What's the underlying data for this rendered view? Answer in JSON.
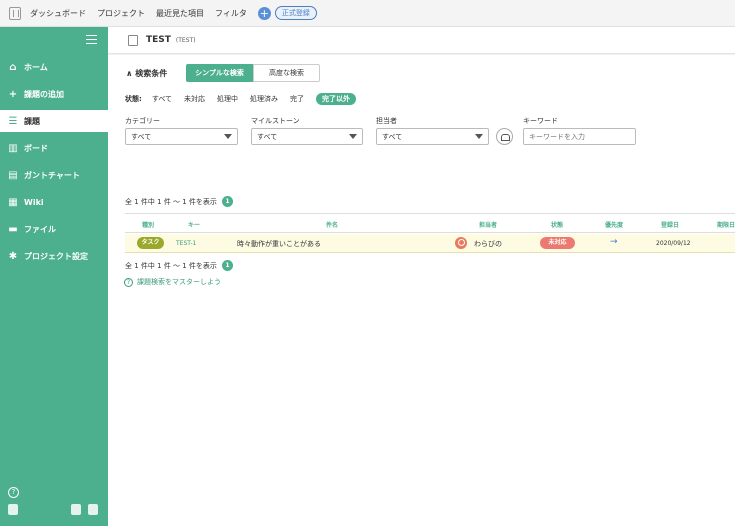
{
  "topbar": {
    "nav": [
      "ダッシュボード",
      "プロジェクト",
      "最近見た項目",
      "フィルタ"
    ],
    "register_label": "正式登録"
  },
  "sidebar": {
    "items": [
      {
        "label": "ホーム",
        "icon": "home-icon"
      },
      {
        "label": "課題の追加",
        "icon": "plus-icon"
      },
      {
        "label": "課題",
        "icon": "list-icon"
      },
      {
        "label": "ボード",
        "icon": "board-icon"
      },
      {
        "label": "ガントチャート",
        "icon": "gantt-icon"
      },
      {
        "label": "Wiki",
        "icon": "wiki-icon"
      },
      {
        "label": "ファイル",
        "icon": "folder-icon"
      },
      {
        "label": "プロジェクト設定",
        "icon": "gear-icon"
      }
    ],
    "active_index": 2
  },
  "project": {
    "name": "TEST",
    "key": "(TEST)"
  },
  "search": {
    "title": "検索条件",
    "tabs": [
      "シンプルな検索",
      "高度な検索"
    ],
    "status_label": "状態:",
    "status_options": [
      "すべて",
      "未対応",
      "処理中",
      "処理済み",
      "完了",
      "完了以外"
    ],
    "selected_status": "完了以外",
    "filters": [
      {
        "label": "カテゴリー",
        "value": "すべて"
      },
      {
        "label": "マイルストーン",
        "value": "すべて"
      },
      {
        "label": "担当者",
        "value": "すべて"
      }
    ],
    "keyword_label": "キーワード",
    "keyword_placeholder": "キーワードを入力"
  },
  "results": {
    "count_text": "全 1 件中 1 件 〜 1 件を表示",
    "count": "1",
    "columns": [
      "種別",
      "キー",
      "件名",
      "担当者",
      "状態",
      "優先度",
      "登録日",
      "期限日"
    ],
    "rows": [
      {
        "type": "タスク",
        "key": "TEST-1",
        "summary": "時々動作が重いことがある",
        "assignee": "わらびの",
        "status": "未対応",
        "priority": "→",
        "created": "2020/09/12"
      }
    ]
  },
  "hint": "課題検索をマスターしよう"
}
